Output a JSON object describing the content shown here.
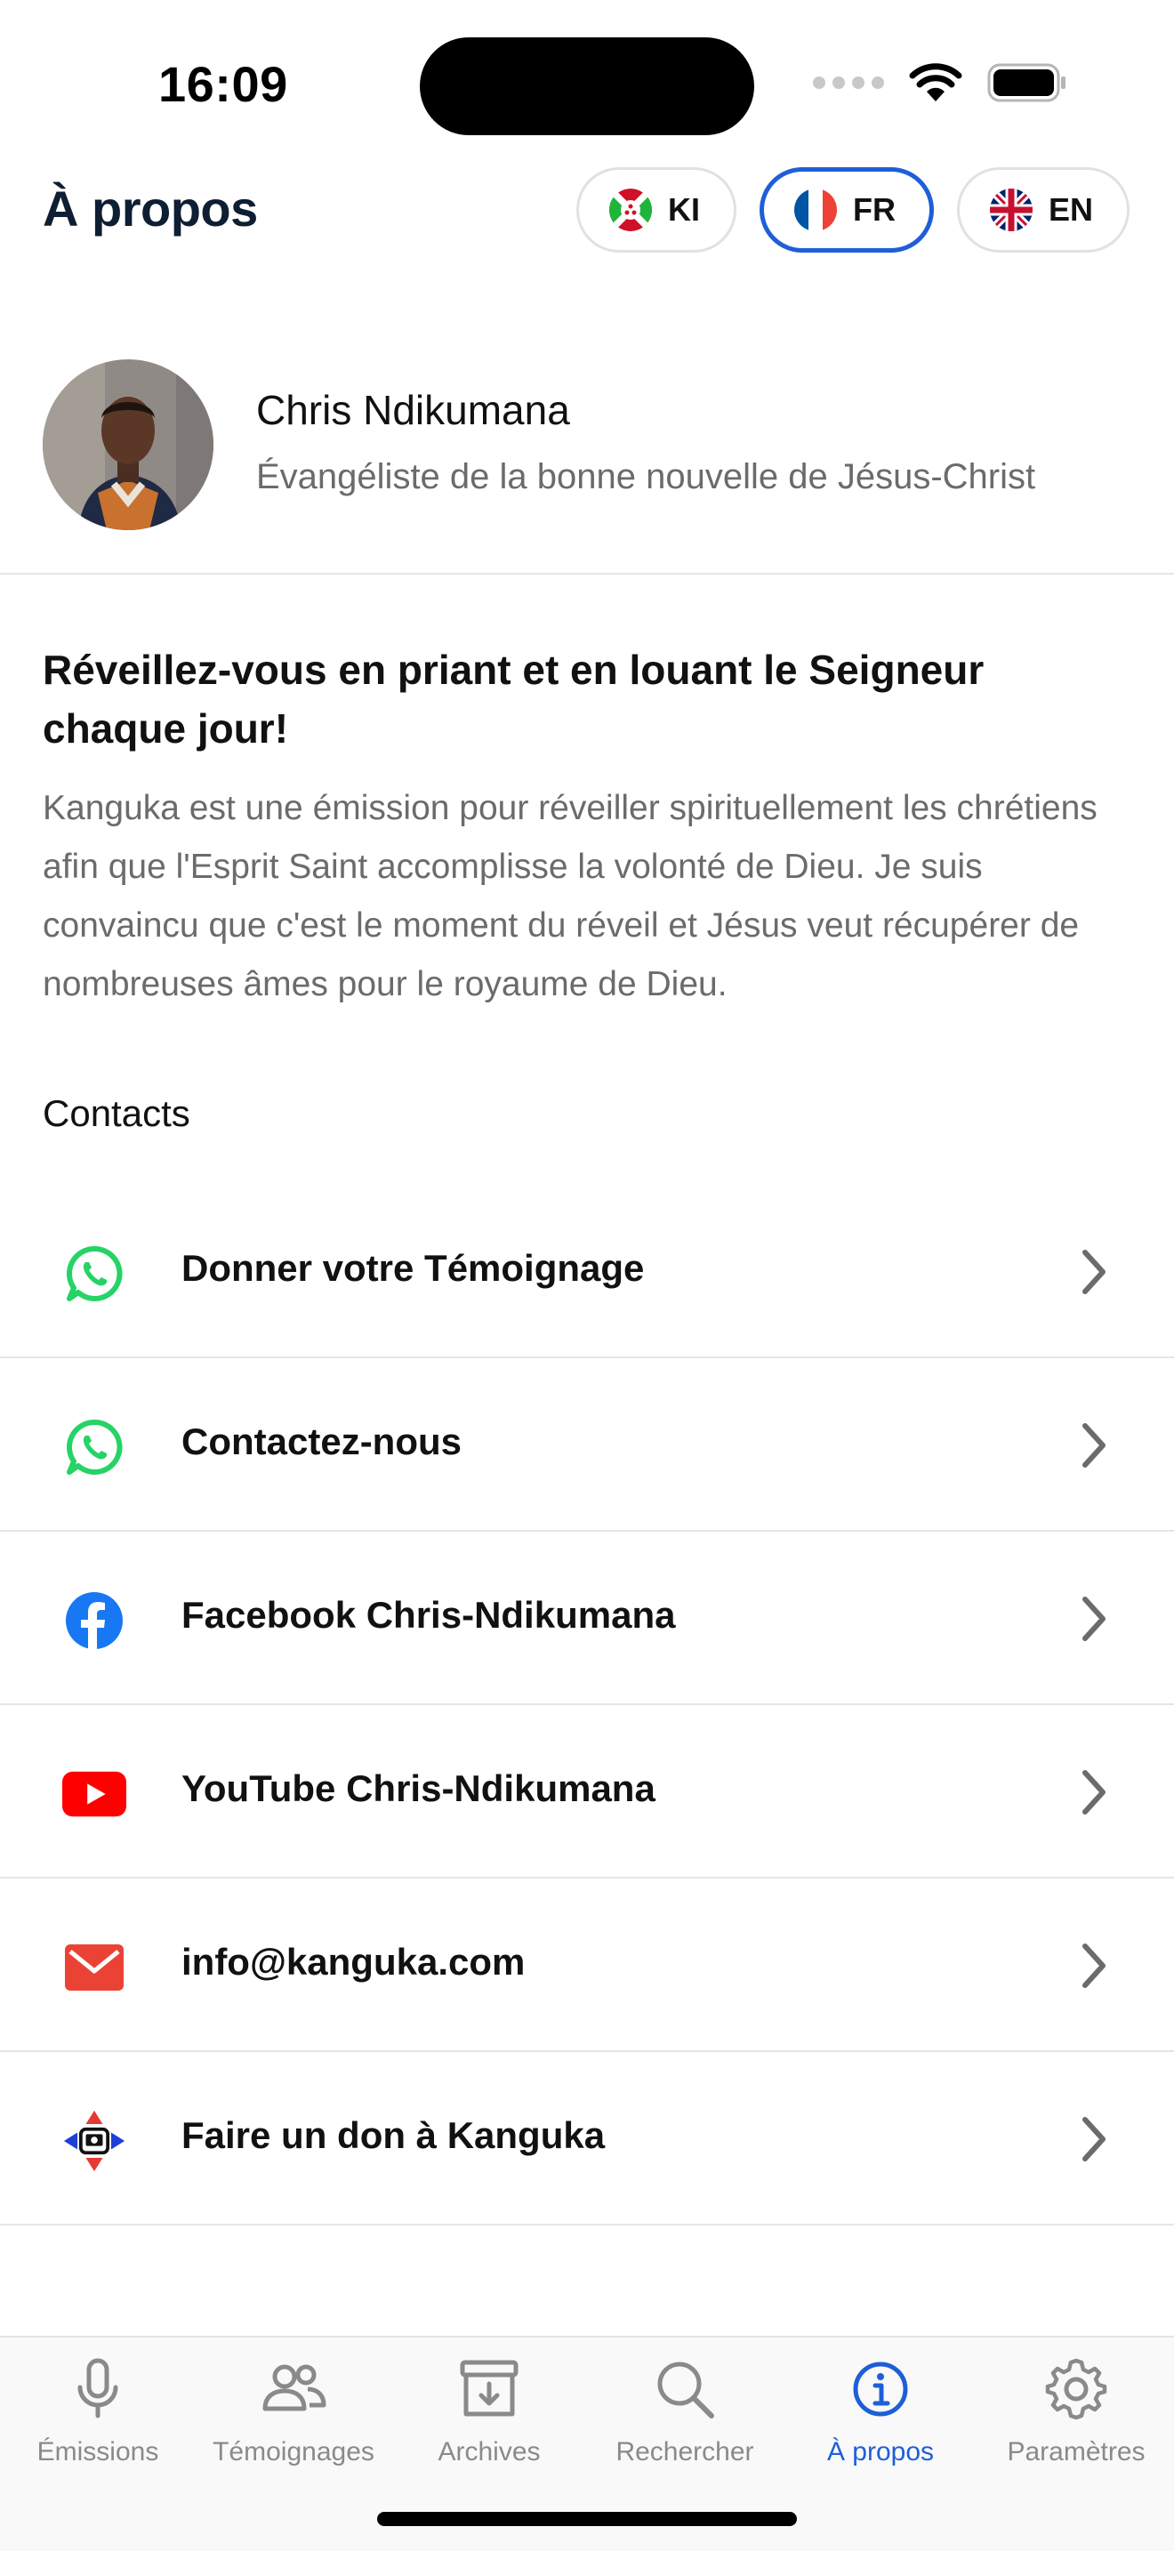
{
  "status_bar": {
    "time": "16:09"
  },
  "header": {
    "title": "À propos",
    "languages": [
      {
        "code": "KI",
        "flag": "burundi-flag",
        "active": false
      },
      {
        "code": "FR",
        "flag": "france-flag",
        "active": true
      },
      {
        "code": "EN",
        "flag": "uk-flag",
        "active": false
      }
    ]
  },
  "profile": {
    "name": "Chris Ndikumana",
    "role": "Évangéliste de la bonne nouvelle de Jésus-Christ"
  },
  "about": {
    "headline": "Réveillez-vous en priant et en louant le Seigneur chaque jour!",
    "description": "Kanguka est une émission pour réveiller spirituellement les chrétiens afin que l'Esprit Saint accomplisse la volonté de Dieu. Je suis convaincu que c'est le moment du réveil et Jésus veut récupérer de nombreuses âmes pour le royaume de Dieu."
  },
  "contacts": {
    "title": "Contacts",
    "items": [
      {
        "label": "Donner votre Témoignage",
        "icon": "whatsapp-icon"
      },
      {
        "label": "Contactez-nous",
        "icon": "whatsapp-icon"
      },
      {
        "label": "Facebook Chris-Ndikumana",
        "icon": "facebook-icon"
      },
      {
        "label": "YouTube Chris-Ndikumana",
        "icon": "youtube-icon"
      },
      {
        "label": "info@kanguka.com",
        "icon": "mail-icon"
      },
      {
        "label": "Faire un don à Kanguka",
        "icon": "donate-icon"
      }
    ]
  },
  "tabs": [
    {
      "label": "Émissions",
      "icon": "microphone-icon",
      "active": false
    },
    {
      "label": "Témoignages",
      "icon": "people-icon",
      "active": false
    },
    {
      "label": "Archives",
      "icon": "archive-icon",
      "active": false
    },
    {
      "label": "Rechercher",
      "icon": "search-icon",
      "active": false
    },
    {
      "label": "À propos",
      "icon": "info-icon",
      "active": true
    },
    {
      "label": "Paramètres",
      "icon": "gear-icon",
      "active": false
    }
  ],
  "colors": {
    "accent": "#1e5fd8",
    "whatsapp": "#25d366",
    "facebook": "#1877f2",
    "youtube": "#ff0000",
    "mail": "#ea4335",
    "muted_text": "#6b6b6b"
  }
}
